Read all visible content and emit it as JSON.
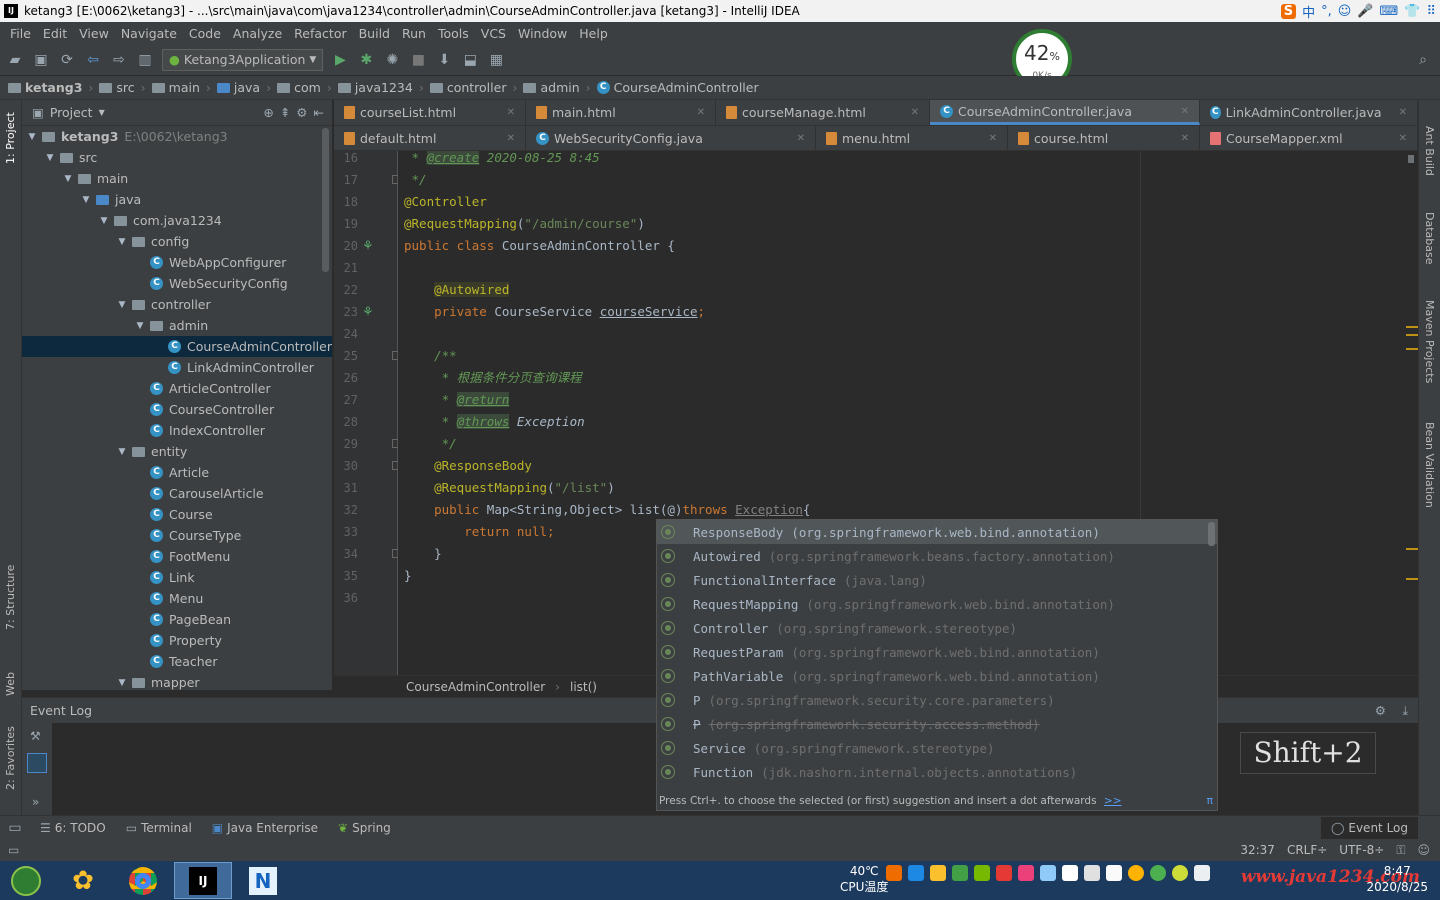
{
  "window": {
    "title": "ketang3 [E:\\0062\\ketang3] - ...\\src\\main\\java\\com\\java1234\\controller\\admin\\CourseAdminController.java [ketang3] - IntelliJ IDEA",
    "ime": [
      "中",
      "°,",
      "☺",
      "🎤",
      "⌨",
      "👕",
      "⠿"
    ]
  },
  "menu": [
    "File",
    "Edit",
    "View",
    "Navigate",
    "Code",
    "Analyze",
    "Refactor",
    "Build",
    "Run",
    "Tools",
    "VCS",
    "Window",
    "Help"
  ],
  "toolbar": {
    "run_config": "Ketang3Application"
  },
  "breadcrumb": [
    "ketang3",
    "src",
    "main",
    "java",
    "com",
    "java1234",
    "controller",
    "admin",
    "CourseAdminController"
  ],
  "project_panel": {
    "title": "Project",
    "tree": [
      {
        "label": "ketang3",
        "extra": "E:\\0062\\ketang3",
        "indent": 0,
        "kind": "module",
        "arrow": "▼"
      },
      {
        "label": "src",
        "indent": 1,
        "kind": "folder",
        "arrow": "▼"
      },
      {
        "label": "main",
        "indent": 2,
        "kind": "folder",
        "arrow": "▼"
      },
      {
        "label": "java",
        "indent": 3,
        "kind": "folder",
        "arrow": "▼"
      },
      {
        "label": "com.java1234",
        "indent": 4,
        "kind": "folder",
        "arrow": "▼"
      },
      {
        "label": "config",
        "indent": 5,
        "kind": "folder",
        "arrow": "▼"
      },
      {
        "label": "WebAppConfigurer",
        "indent": 6,
        "kind": "class"
      },
      {
        "label": "WebSecurityConfig",
        "indent": 6,
        "kind": "class"
      },
      {
        "label": "controller",
        "indent": 5,
        "kind": "folder",
        "arrow": "▼"
      },
      {
        "label": "admin",
        "indent": 6,
        "kind": "folder",
        "arrow": "▼"
      },
      {
        "label": "CourseAdminController",
        "indent": 7,
        "kind": "class",
        "selected": true
      },
      {
        "label": "LinkAdminController",
        "indent": 7,
        "kind": "class"
      },
      {
        "label": "ArticleController",
        "indent": 6,
        "kind": "class"
      },
      {
        "label": "CourseController",
        "indent": 6,
        "kind": "class"
      },
      {
        "label": "IndexController",
        "indent": 6,
        "kind": "class"
      },
      {
        "label": "entity",
        "indent": 5,
        "kind": "folder",
        "arrow": "▼"
      },
      {
        "label": "Article",
        "indent": 6,
        "kind": "class"
      },
      {
        "label": "CarouselArticle",
        "indent": 6,
        "kind": "class"
      },
      {
        "label": "Course",
        "indent": 6,
        "kind": "class"
      },
      {
        "label": "CourseType",
        "indent": 6,
        "kind": "class"
      },
      {
        "label": "FootMenu",
        "indent": 6,
        "kind": "class"
      },
      {
        "label": "Link",
        "indent": 6,
        "kind": "class"
      },
      {
        "label": "Menu",
        "indent": 6,
        "kind": "class"
      },
      {
        "label": "PageBean",
        "indent": 6,
        "kind": "class"
      },
      {
        "label": "Property",
        "indent": 6,
        "kind": "class"
      },
      {
        "label": "Teacher",
        "indent": 6,
        "kind": "class"
      },
      {
        "label": "mapper",
        "indent": 5,
        "kind": "folder",
        "arrow": "▼"
      }
    ]
  },
  "editor_tabs_row1": [
    {
      "label": "courseList.html",
      "kind": "html"
    },
    {
      "label": "main.html",
      "kind": "html"
    },
    {
      "label": "courseManage.html",
      "kind": "html"
    },
    {
      "label": "CourseAdminController.java",
      "kind": "java",
      "active": true
    },
    {
      "label": "LinkAdminController.java",
      "kind": "java"
    }
  ],
  "editor_tabs_row2": [
    {
      "label": "default.html",
      "kind": "html"
    },
    {
      "label": "WebSecurityConfig.java",
      "kind": "java"
    },
    {
      "label": "menu.html",
      "kind": "html"
    },
    {
      "label": "course.html",
      "kind": "html"
    },
    {
      "label": "CourseMapper.xml",
      "kind": "xml"
    }
  ],
  "code_lines": [
    {
      "n": "16",
      "html": "<span class='cm'> * </span><span class='tg'>@create</span><span class='cm'> 2020-08-25 8:45</span>"
    },
    {
      "n": "17",
      "html": "<span class='cm'> */</span>"
    },
    {
      "n": "18",
      "html": "<span class='an'>@Controller</span>"
    },
    {
      "n": "19",
      "html": "<span class='an'>@RequestMapping</span><span class='pl'>(</span><span class='st'>\"/admin/course\"</span><span class='pl'>)</span>"
    },
    {
      "n": "20",
      "html": "<span class='kw'>public class </span><span class='pl'>CourseAdminController {</span>"
    },
    {
      "n": "21",
      "html": ""
    },
    {
      "n": "22",
      "html": "    <span class='an' style='background:#3b3b2a'>@Autowired</span>"
    },
    {
      "n": "23",
      "html": "    <span class='kw'>private </span><span class='pl'>CourseService </span><span class='ul'>courseService</span><span class='kw'>;</span>"
    },
    {
      "n": "24",
      "html": ""
    },
    {
      "n": "25",
      "html": "    <span class='cm'>/**</span>"
    },
    {
      "n": "26",
      "html": "<span class='cm'>     * 根据条件分页查询课程</span>"
    },
    {
      "n": "27",
      "html": "<span class='cm'>     * </span><span class='tg'>@return</span>"
    },
    {
      "n": "28",
      "html": "<span class='cm'>     * </span><span class='tg'>@throws</span><span class='cm' style='color:#a9b7c6'> Exception</span>"
    },
    {
      "n": "29",
      "html": "<span class='cm'>     */</span>"
    },
    {
      "n": "30",
      "html": "    <span class='an'>@ResponseBody</span>"
    },
    {
      "n": "31",
      "html": "    <span class='an'>@RequestMapping</span><span class='pl'>(</span><span class='st'>\"/list\"</span><span class='pl'>)</span>"
    },
    {
      "n": "32",
      "html": "    <span class='kw'>public </span><span class='pl'>Map&lt;String,Object&gt; list(@)</span><span class='kw'>throws </span><span class='gr' style='text-decoration:underline'>Exception</span><span class='pl'>{</span>"
    },
    {
      "n": "33",
      "html": "        <span class='kw'>return null;</span>"
    },
    {
      "n": "34",
      "html": "    <span class='pl'>}</span>"
    },
    {
      "n": "35",
      "html": "<span class='pl'>}</span>"
    },
    {
      "n": "36",
      "html": ""
    }
  ],
  "editor_breadcrumb": [
    "CourseAdminController",
    "list()"
  ],
  "completion": {
    "items": [
      {
        "name": "ResponseBody",
        "pkg": "(org.springframework.web.bind.annotation)",
        "selected": true
      },
      {
        "name": "Autowired",
        "pkg": "(org.springframework.beans.factory.annotation)"
      },
      {
        "name": "FunctionalInterface",
        "pkg": "(java.lang)"
      },
      {
        "name": "RequestMapping",
        "pkg": "(org.springframework.web.bind.annotation)"
      },
      {
        "name": "Controller",
        "pkg": "(org.springframework.stereotype)"
      },
      {
        "name": "RequestParam",
        "pkg": "(org.springframework.web.bind.annotation)"
      },
      {
        "name": "PathVariable",
        "pkg": "(org.springframework.web.bind.annotation)"
      },
      {
        "name": "P",
        "pkg": "(org.springframework.security.core.parameters)"
      },
      {
        "name": "P",
        "pkg": "(org.springframework.security.access.method)",
        "strike": true
      },
      {
        "name": "Service",
        "pkg": "(org.springframework.stereotype)"
      },
      {
        "name": "Function",
        "pkg": "(jdk.nashorn.internal.objects.annotations)"
      }
    ],
    "footer": "Press Ctrl+. to choose the selected (or first) suggestion and insert a dot afterwards",
    "footer_link": ">>",
    "footer_pi": "π"
  },
  "event_log": {
    "title": "Event Log"
  },
  "key_overlay": "Shift+2",
  "gauge": {
    "percent": "42",
    "unit": "%",
    "rate": "0K/s"
  },
  "left_strip": [
    "1: Project",
    "7: Structure",
    "Web",
    "2: Favorites"
  ],
  "right_strip": [
    "Ant Build",
    "Database",
    "Maven Projects",
    "Bean Validation"
  ],
  "bottom_tools": [
    "6: TODO",
    "Terminal",
    "Java Enterprise",
    "Spring"
  ],
  "bottom_right": "Event Log",
  "status": {
    "position": "32:37",
    "line_sep": "CRLF÷",
    "encoding": "UTF-8÷"
  },
  "taskbar": {
    "temp": "40℃",
    "temp_label": "CPU温度",
    "time": "8:47",
    "date": "2020/8/25",
    "watermark": "www.java1234.com"
  }
}
